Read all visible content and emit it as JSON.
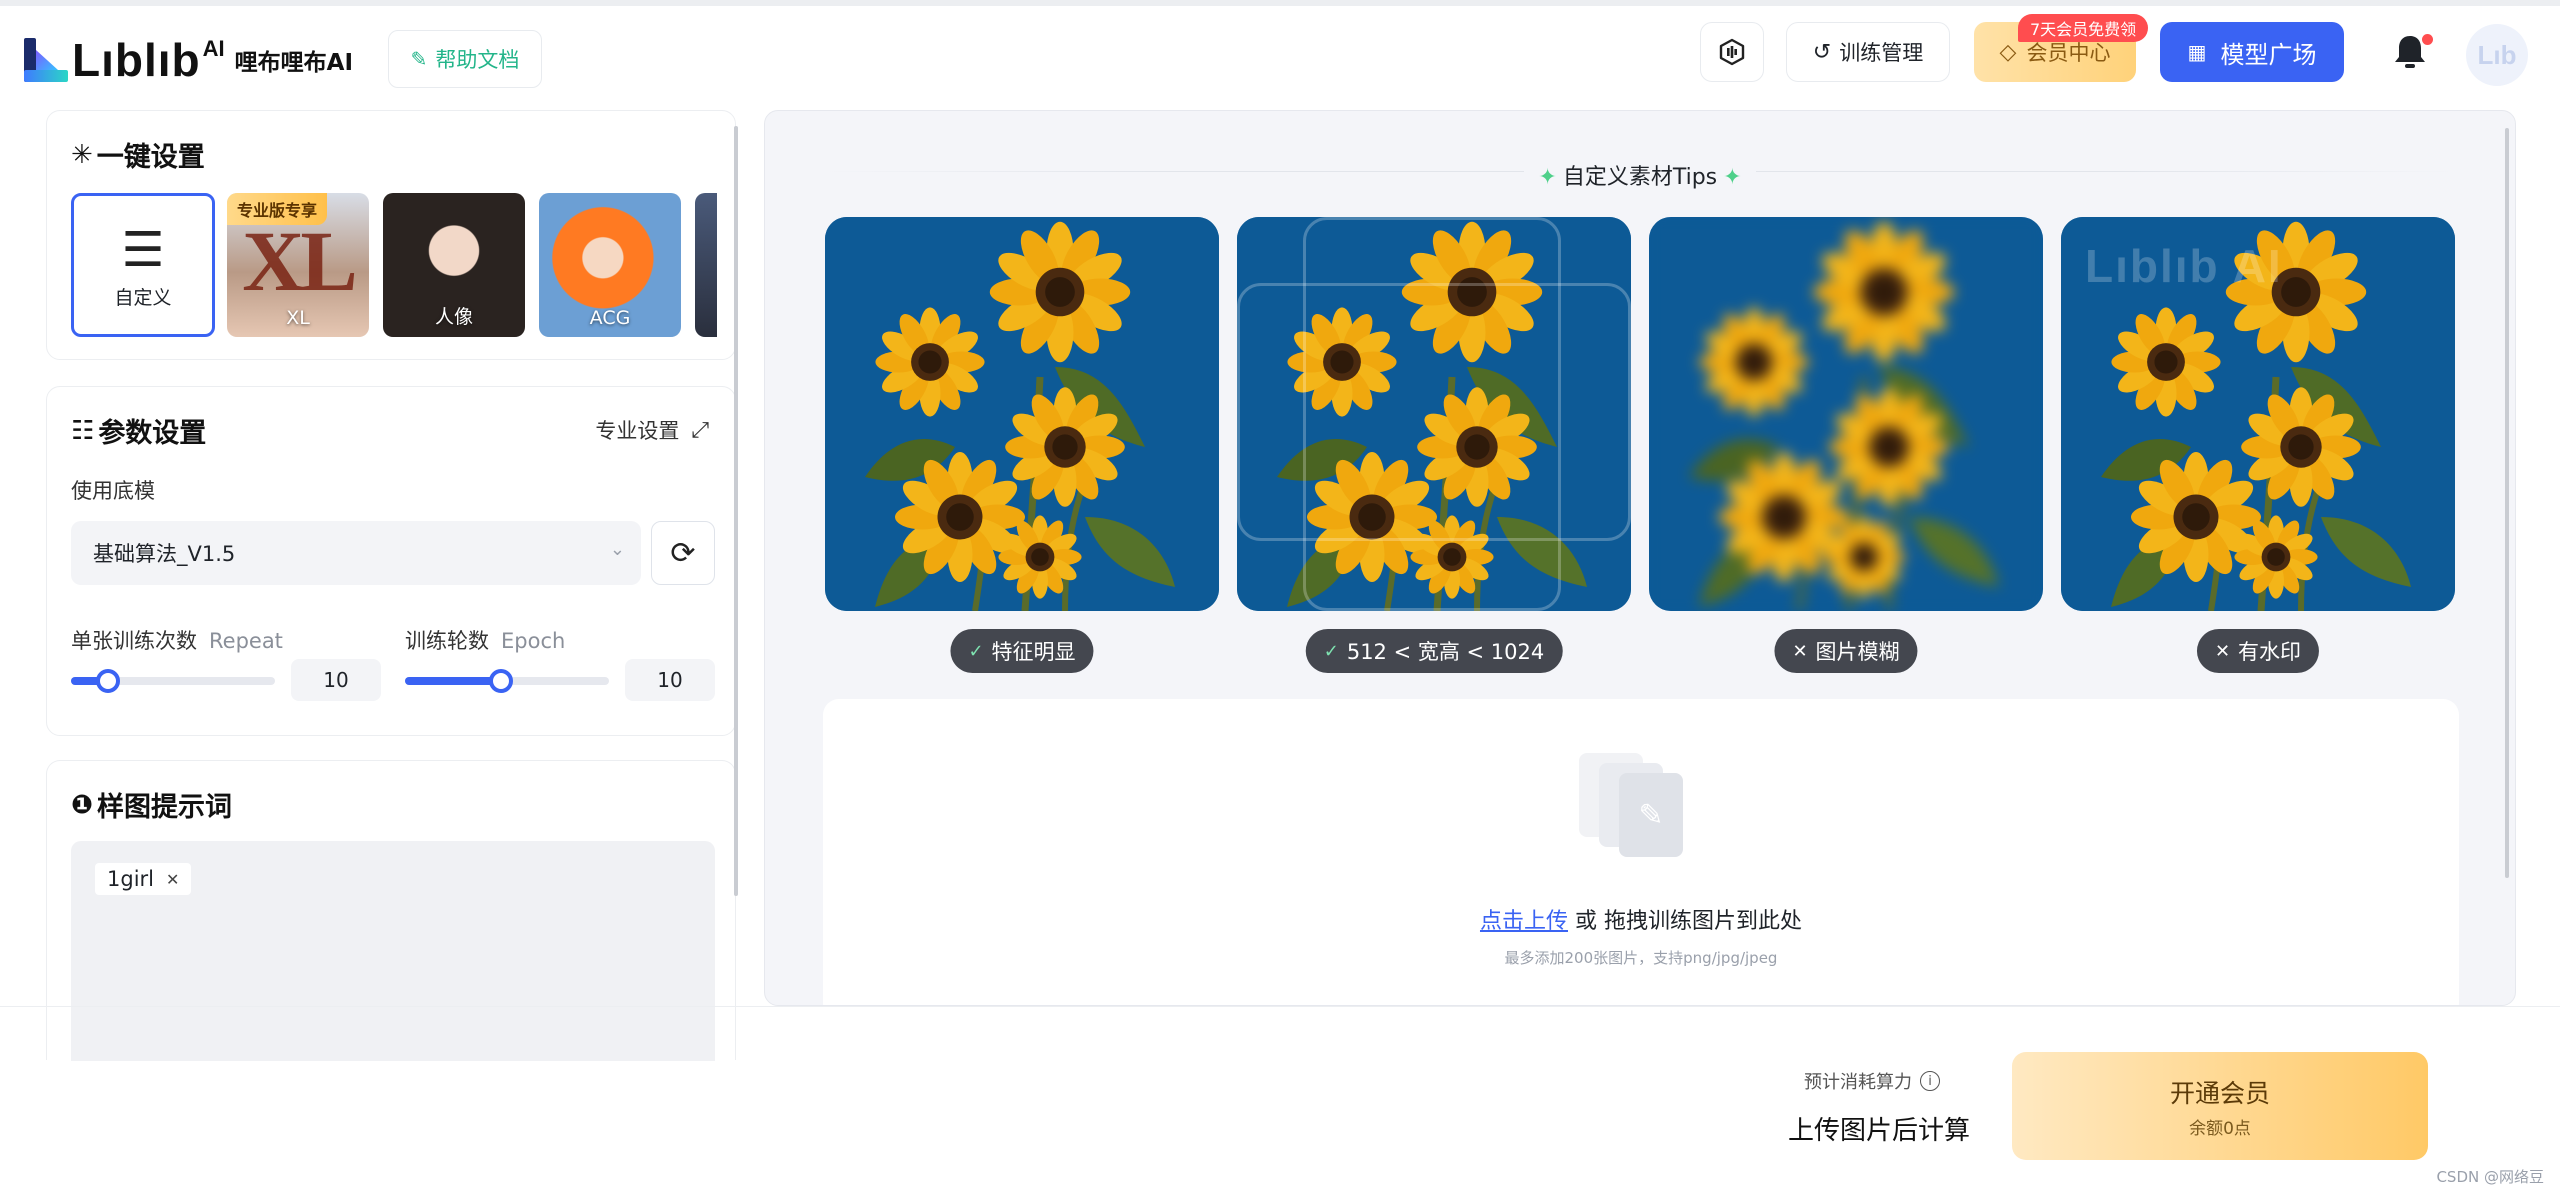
{
  "header": {
    "logo_word": "Lıblıb",
    "logo_sup": "AI",
    "logo_cn": "哩布哩布AI",
    "help_label": "帮助文档",
    "train_label": "训练管理",
    "member_label": "会员中心",
    "member_badge": "7天会员免费领",
    "market_label": "模型广场",
    "avatar_text": "Lıb",
    "accent_color": "#3a63f3"
  },
  "presets": {
    "title": "一键设置",
    "items": [
      {
        "label": "自定义",
        "selected": true
      },
      {
        "label": "XL",
        "badge": "专业版专享",
        "art": "XL"
      },
      {
        "label": "人像"
      },
      {
        "label": "ACG"
      }
    ]
  },
  "params": {
    "title": "参数设置",
    "pro_setting": "专业设置",
    "model_label": "使用底模",
    "model_value": "基础算法_V1.5",
    "repeat": {
      "label": "单张训练次数",
      "label_en": "Repeat",
      "value": "10",
      "fraction": 0.18
    },
    "epoch": {
      "label": "训练轮数",
      "label_en": "Epoch",
      "value": "10",
      "fraction": 0.47
    }
  },
  "prompt": {
    "title": "样图提示词",
    "tags": [
      "1girl"
    ]
  },
  "tips": {
    "title": "自定义素材Tips",
    "watermark_text": "Lıblıb AI",
    "items": [
      {
        "label": "特征明显",
        "ok": true,
        "icon": "check-icon"
      },
      {
        "label": "512 < 宽高 < 1024",
        "ok": true,
        "icon": "check-icon"
      },
      {
        "label": "图片模糊",
        "ok": false,
        "icon": "cross-icon"
      },
      {
        "label": "有水印",
        "ok": false,
        "icon": "cross-icon"
      }
    ]
  },
  "upload": {
    "link_text": "点击上传",
    "or_text": " 或 拖拽训练图片到此处",
    "hint": "最多添加200张图片，支持png/jpg/jpeg"
  },
  "footer": {
    "cost_label": "预计消耗算力",
    "cost_value": "上传图片后计算",
    "open_label": "开通会员",
    "balance": "余额0点",
    "credit": "CSDN @网络豆"
  }
}
